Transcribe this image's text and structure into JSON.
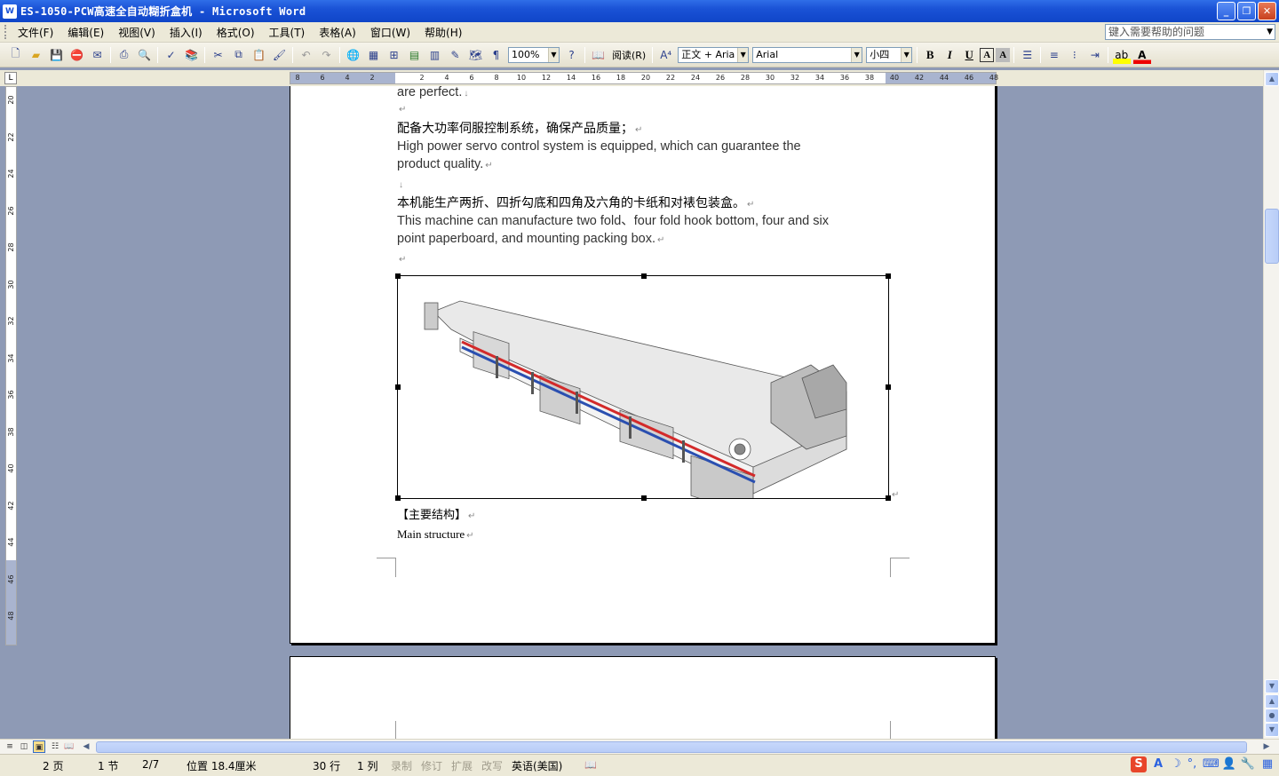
{
  "window": {
    "title": "ES-1050-PCW高速全自动糊折盒机 - Microsoft Word",
    "app_icon": "W"
  },
  "menu": {
    "items": [
      "文件(F)",
      "编辑(E)",
      "视图(V)",
      "插入(I)",
      "格式(O)",
      "工具(T)",
      "表格(A)",
      "窗口(W)",
      "帮助(H)"
    ],
    "help_placeholder": "键入需要帮助的问题"
  },
  "toolbar": {
    "zoom": "100%",
    "read_label": "阅读(R)",
    "style": "正文 + Aria",
    "font": "Arial",
    "size": "小四"
  },
  "ruler": {
    "h_ticks": [
      "8",
      "6",
      "4",
      "2",
      "",
      "2",
      "4",
      "6",
      "8",
      "10",
      "12",
      "14",
      "16",
      "18",
      "20",
      "22",
      "24",
      "26",
      "28",
      "30",
      "32",
      "34",
      "36",
      "38",
      "40",
      "42",
      "44",
      "46",
      "48"
    ],
    "v_ticks": [
      "20",
      "22",
      "24",
      "26",
      "28",
      "30",
      "32",
      "34",
      "36",
      "38",
      "40",
      "42",
      "44",
      "46",
      "48"
    ]
  },
  "document": {
    "line_top": "are perfect.",
    "p1_cn": "配备大功率伺服控制系统，确保产品质量；",
    "p1_en_1": "High power servo control system is equipped, which can guarantee the",
    "p1_en_2": "product quality.",
    "p2_cn": "本机能生产两折、四折勾底和四角及六角的卡纸和对裱包装盒。",
    "p2_en_1": "This machine can manufacture two fold、four fold hook bottom, four and six",
    "p2_en_2": "point paperboard, and mounting packing box.",
    "heading_cn": "【主要结构】",
    "heading_en": "Main structure",
    "para_mark": "↵",
    "line_mark": "↓"
  },
  "statusbar": {
    "page": "2 页",
    "section": "1 节",
    "page_of": "2/7",
    "position": "位置 18.4厘米",
    "line": "30 行",
    "column": "1 列",
    "rec": "录制",
    "trk": "修订",
    "ext": "扩展",
    "ovr": "改写",
    "language": "英语(美国)"
  },
  "colors": {
    "titlebar": "#1a52d6",
    "chrome": "#ece9d8",
    "workspace": "#8e9ab5",
    "stripe_red": "#d32a2a",
    "stripe_blue": "#2a4fb0"
  }
}
